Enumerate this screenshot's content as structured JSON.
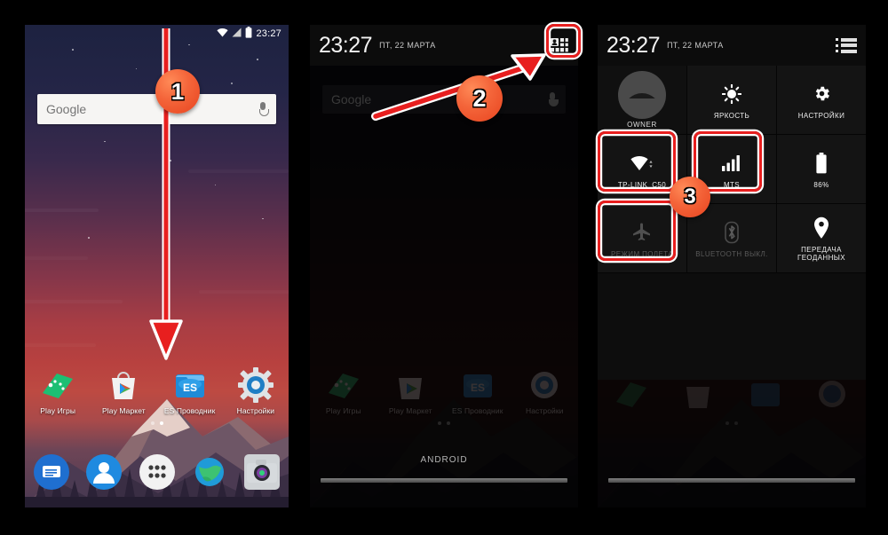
{
  "panels": {
    "phone1": {
      "name": "android-homescreen",
      "statusbar": {
        "time": "23:27",
        "wifi_icon": "wifi-icon",
        "signal_icon": "cellular-signal-icon",
        "battery_icon": "battery-icon"
      },
      "search_widget": {
        "placeholder": "Google",
        "mic_icon": "microphone-icon"
      },
      "apps": [
        {
          "label": "Play Игры",
          "icon": "play-games-icon"
        },
        {
          "label": "Play Маркет",
          "icon": "play-store-icon"
        },
        {
          "label": "ES Проводник",
          "icon": "es-file-explorer-icon"
        },
        {
          "label": "Настройки",
          "icon": "settings-gear-icon"
        }
      ],
      "page_dots": {
        "count": 2,
        "active_index": 1
      },
      "dock": [
        {
          "icon": "messaging-icon"
        },
        {
          "icon": "contacts-icon"
        },
        {
          "icon": "all-apps-icon"
        },
        {
          "icon": "browser-globe-icon"
        },
        {
          "icon": "camera-icon"
        }
      ]
    },
    "phone2": {
      "name": "notification-shade",
      "header": {
        "time": "23:27",
        "date": "ПТ, 22 МАРТА",
        "right_icon": "quick-settings-toggle-icon"
      },
      "search_widget": {
        "placeholder": "Google",
        "mic_icon": "microphone-icon"
      },
      "handle_label": "ANDROID",
      "apps": [
        {
          "label": "Play Игры"
        },
        {
          "label": "Play Маркет"
        },
        {
          "label": "ES Проводник"
        },
        {
          "label": "Настройки"
        }
      ]
    },
    "phone3": {
      "name": "quick-settings-panel",
      "header": {
        "time": "23:27",
        "date": "ПТ, 22 МАРТА",
        "right_icon": "notifications-list-icon"
      },
      "tiles": [
        [
          {
            "label": "OWNER",
            "icon": "user-avatar-icon",
            "state": "user"
          },
          {
            "label": "ЯРКОСТЬ",
            "icon": "brightness-sun-icon",
            "state": "on"
          },
          {
            "label": "НАСТРОЙКИ",
            "icon": "settings-gear-icon",
            "state": "on"
          }
        ],
        [
          {
            "label": "TP-LINK_C50",
            "icon": "wifi-icon",
            "state": "on",
            "highlighted": true
          },
          {
            "label": "MTS",
            "icon": "cellular-signal-icon",
            "state": "on",
            "highlighted": true
          },
          {
            "label": "86%",
            "icon": "battery-icon",
            "state": "on"
          }
        ],
        [
          {
            "label": "РЕЖИМ ПОЛЕТА",
            "icon": "airplane-icon",
            "state": "off",
            "highlighted": true
          },
          {
            "label": "BLUETOOTH ВЫКЛ.",
            "icon": "bluetooth-icon",
            "state": "off"
          },
          {
            "label": "ПЕРЕДАЧА ГЕОДАННЫХ",
            "icon": "location-pin-icon",
            "state": "on"
          }
        ]
      ]
    }
  },
  "annotations": {
    "step1": {
      "label": "1",
      "type": "swipe-down-arrow"
    },
    "step2": {
      "label": "2",
      "type": "pointer-arrow"
    },
    "step3": {
      "label": "3",
      "type": "highlight-marker"
    }
  },
  "colors": {
    "accent_badge": "#ef5a2c",
    "highlight_red": "#e81f1f",
    "highlight_white": "#ffffff",
    "background": "#000000"
  }
}
